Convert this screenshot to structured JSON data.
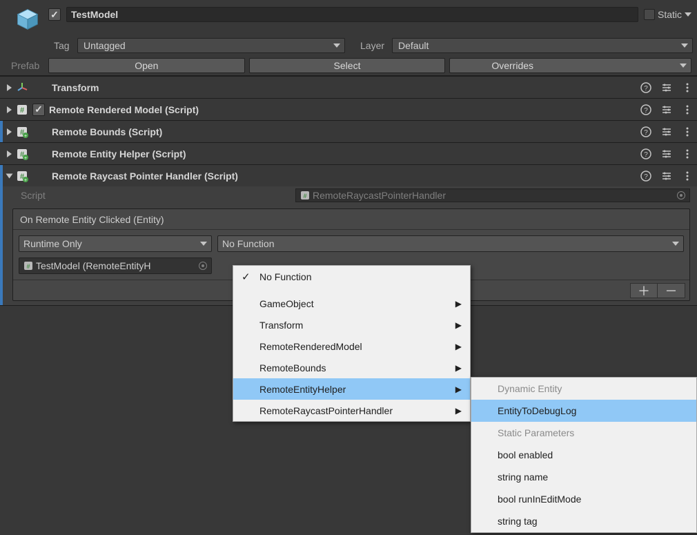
{
  "header": {
    "name": "TestModel",
    "static_label": "Static",
    "tag_label": "Tag",
    "tag_value": "Untagged",
    "layer_label": "Layer",
    "layer_value": "Default",
    "prefab_label": "Prefab",
    "open_btn": "Open",
    "select_btn": "Select",
    "overrides_btn": "Overrides"
  },
  "components": [
    {
      "title": "Transform",
      "has_checkbox": false
    },
    {
      "title": "Remote Rendered Model (Script)",
      "has_checkbox": true
    },
    {
      "title": "Remote Bounds (Script)",
      "has_checkbox": false
    },
    {
      "title": "Remote Entity Helper (Script)",
      "has_checkbox": false
    },
    {
      "title": "Remote Raycast Pointer Handler (Script)",
      "has_checkbox": false
    }
  ],
  "script_row": {
    "label": "Script",
    "value": "RemoteRaycastPointerHandler"
  },
  "event": {
    "header": "On Remote Entity Clicked (Entity)",
    "runtime": "Runtime Only",
    "target": "TestModel (RemoteEntityH",
    "func": "No Function"
  },
  "popup1": {
    "items": [
      {
        "label": "No Function",
        "checked": true,
        "submenu": false
      },
      {
        "label": "GameObject",
        "checked": false,
        "submenu": true
      },
      {
        "label": "Transform",
        "checked": false,
        "submenu": true
      },
      {
        "label": "RemoteRenderedModel",
        "checked": false,
        "submenu": true
      },
      {
        "label": "RemoteBounds",
        "checked": false,
        "submenu": true
      },
      {
        "label": "RemoteEntityHelper",
        "checked": false,
        "submenu": true,
        "selected": true
      },
      {
        "label": "RemoteRaycastPointerHandler",
        "checked": false,
        "submenu": true
      }
    ]
  },
  "popup2": {
    "heading1": "Dynamic Entity",
    "dynamic": [
      {
        "label": "EntityToDebugLog",
        "selected": true
      }
    ],
    "heading2": "Static Parameters",
    "static": [
      {
        "label": "bool enabled"
      },
      {
        "label": "string name"
      },
      {
        "label": "bool runInEditMode"
      },
      {
        "label": "string tag"
      }
    ]
  }
}
